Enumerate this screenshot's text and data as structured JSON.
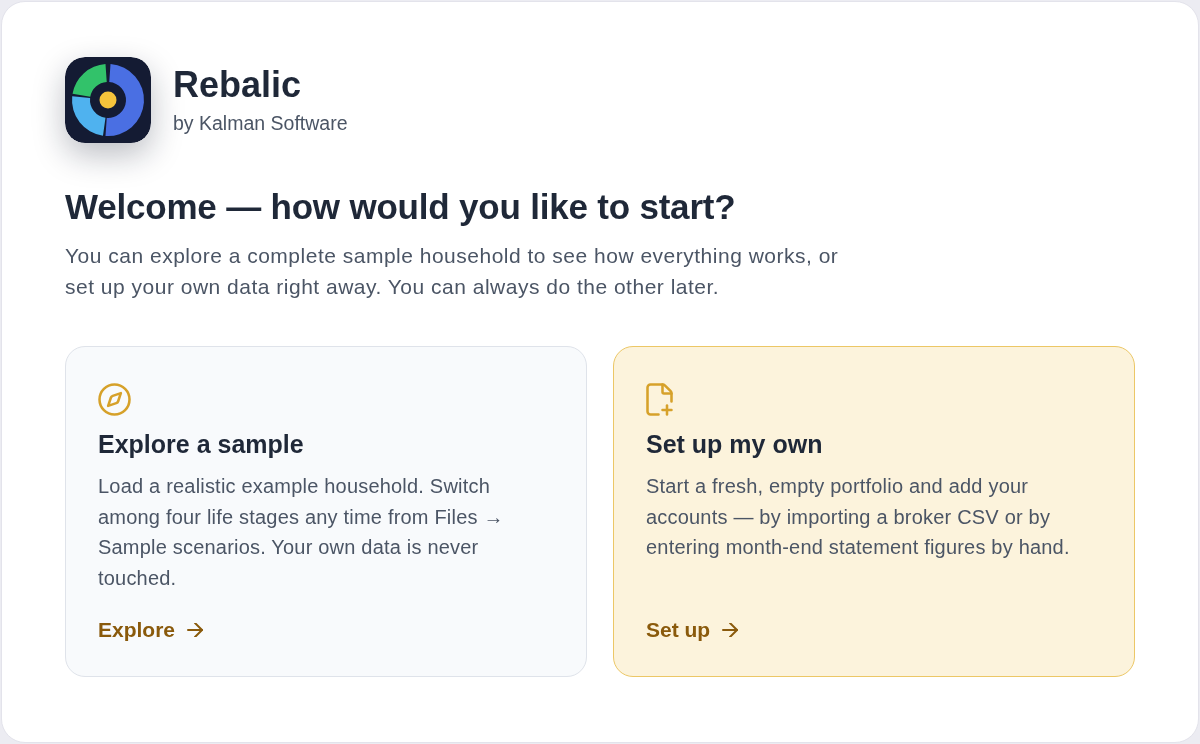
{
  "app": {
    "name": "Rebalic",
    "publisher": "by Kalman Software"
  },
  "welcome": {
    "title": "Welcome — how would you like to start?",
    "description": "You can explore a complete sample household to see how everything works, or set up your own data right away. You can always do the other later."
  },
  "options": [
    {
      "kind": "sample",
      "selected": false,
      "title": "Explore a sample",
      "description": "Load a realistic example household. Switch among four life stages any time from Files → Sample scenarios. Your own data is never touched.",
      "action": "Explore"
    },
    {
      "kind": "own",
      "selected": true,
      "title": "Set up my own",
      "description": "Start a fresh, empty portfolio and add your accounts — by importing a broker CSV or by entering month-end statement figures by hand.",
      "action": "Set up"
    }
  ]
}
